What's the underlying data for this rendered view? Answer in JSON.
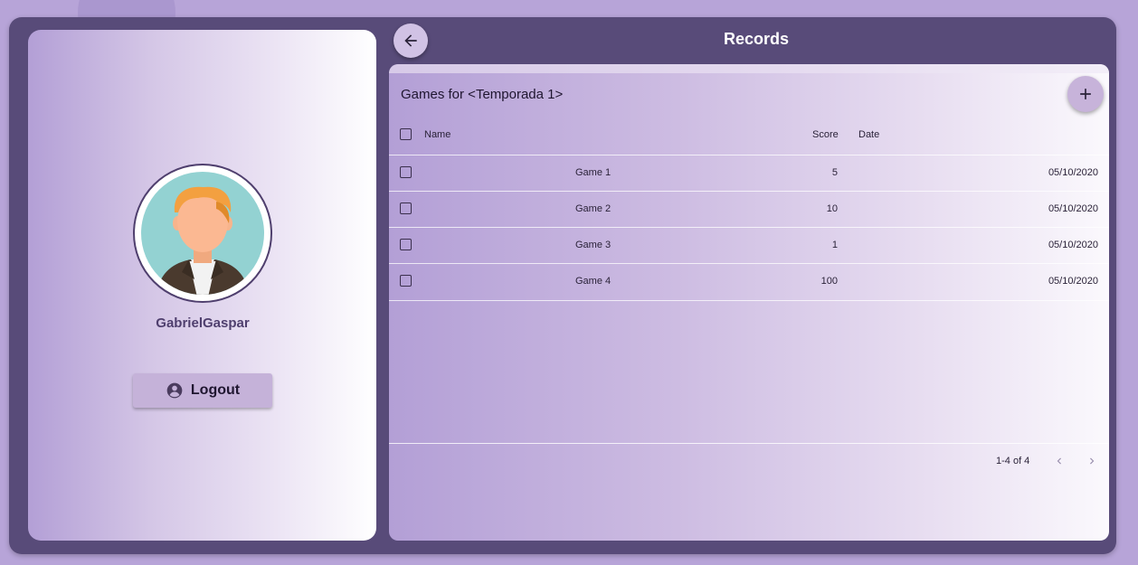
{
  "header": {
    "title": "Records"
  },
  "profile": {
    "username": "GabrielGaspar",
    "logout_label": "Logout"
  },
  "table": {
    "title": "Games for <Temporada 1>",
    "columns": {
      "name": "Name",
      "score": "Score",
      "date": "Date"
    },
    "rows": [
      {
        "name": "Game 1",
        "score": "5",
        "date": "05/10/2020"
      },
      {
        "name": "Game 2",
        "score": "10",
        "date": "05/10/2020"
      },
      {
        "name": "Game 3",
        "score": "1",
        "date": "05/10/2020"
      },
      {
        "name": "Game 4",
        "score": "100",
        "date": "05/10/2020"
      }
    ]
  },
  "pagination": {
    "range_label": "1-4 of 4"
  },
  "icons": {
    "back": "arrow-left-icon",
    "add": "plus-icon",
    "logout": "account-circle-icon",
    "prev": "chevron-left-icon",
    "next": "chevron-right-icon"
  },
  "colors": {
    "background": "#b7a4d8",
    "frame": "#584b79",
    "accent": "#c5b2d9",
    "text_dark": "#1f1630",
    "username": "#4f3f6e"
  }
}
